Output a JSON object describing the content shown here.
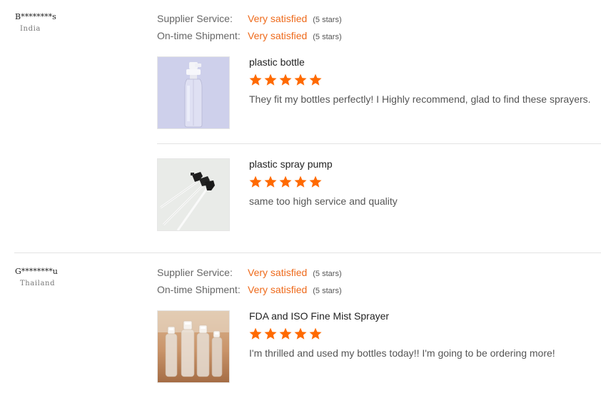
{
  "labels": {
    "supplier_service": "Supplier Service:",
    "ontime_shipment": "On-time Shipment:"
  },
  "colors": {
    "accent": "#ee6a1b",
    "star": "#ff6a00"
  },
  "reviews": [
    {
      "buyer": "B********s",
      "country": "India",
      "supplier_service": {
        "value": "Very satisfied",
        "stars_text": "(5 stars)",
        "stars": 5
      },
      "ontime_shipment": {
        "value": "Very satisfied",
        "stars_text": "(5 stars)",
        "stars": 5
      },
      "items": [
        {
          "title": "plastic bottle",
          "rating": 5,
          "comment": "They fit my bottles perfectly! I Highly recommend, glad to find these sprayers.",
          "thumb_icon": "plastic-bottle-photo"
        },
        {
          "title": "plastic spray pump",
          "rating": 5,
          "comment": "same too high service and quality",
          "thumb_icon": "spray-pump-photo"
        }
      ]
    },
    {
      "buyer": "G********u",
      "country": "Thailand",
      "supplier_service": {
        "value": "Very satisfied",
        "stars_text": "(5 stars)",
        "stars": 5
      },
      "ontime_shipment": {
        "value": "Very satisfied",
        "stars_text": "(5 stars)",
        "stars": 5
      },
      "items": [
        {
          "title": "FDA and ISO Fine Mist Sprayer",
          "rating": 5,
          "comment": "I'm thrilled and used my bottles today!! I'm going to be ordering more!",
          "thumb_icon": "mist-sprayer-bottles-photo"
        }
      ]
    }
  ]
}
